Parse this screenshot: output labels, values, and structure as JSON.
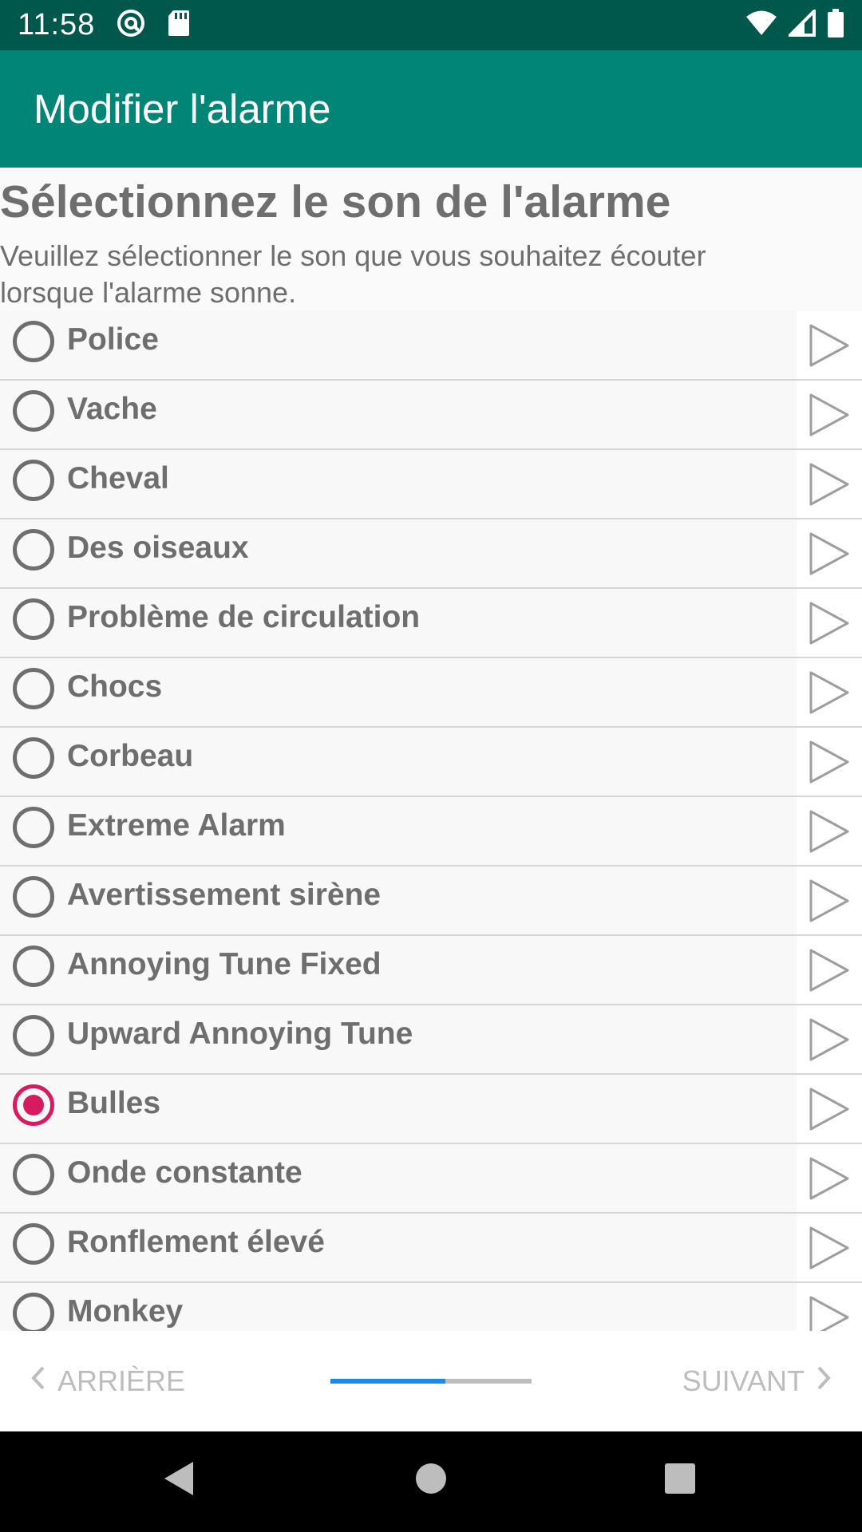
{
  "status_bar": {
    "time": "11:58",
    "left_icons": [
      "at-sign-icon",
      "sd-card-icon"
    ],
    "right_icons": [
      "wifi-icon",
      "signal-icon",
      "battery-icon"
    ]
  },
  "app_bar": {
    "title": "Modifier l'alarme"
  },
  "header": {
    "title": "Sélectionnez le son de l'alarme",
    "subtitle": "Veuillez sélectionner le son que vous souhaitez écouter lorsque l'alarme sonne."
  },
  "sounds": [
    {
      "label": "Police",
      "selected": false
    },
    {
      "label": "Vache",
      "selected": false
    },
    {
      "label": "Cheval",
      "selected": false
    },
    {
      "label": "Des oiseaux",
      "selected": false
    },
    {
      "label": "Problème de circulation",
      "selected": false
    },
    {
      "label": "Chocs",
      "selected": false
    },
    {
      "label": "Corbeau",
      "selected": false
    },
    {
      "label": "Extreme Alarm",
      "selected": false
    },
    {
      "label": "Avertissement sirène",
      "selected": false
    },
    {
      "label": "Annoying Tune Fixed",
      "selected": false
    },
    {
      "label": "Upward Annoying Tune",
      "selected": false
    },
    {
      "label": "Bulles",
      "selected": true
    },
    {
      "label": "Onde constante",
      "selected": false
    },
    {
      "label": "Ronflement élevé",
      "selected": false
    },
    {
      "label": "Monkey",
      "selected": false
    }
  ],
  "bottom_nav": {
    "back_label": "ARRIÈRE",
    "next_label": "SUIVANT",
    "progress_fraction": 0.57
  },
  "colors": {
    "status_bar": "#00574b",
    "app_bar": "#008577",
    "accent": "#d81b60",
    "progress": "#1e88e5"
  }
}
